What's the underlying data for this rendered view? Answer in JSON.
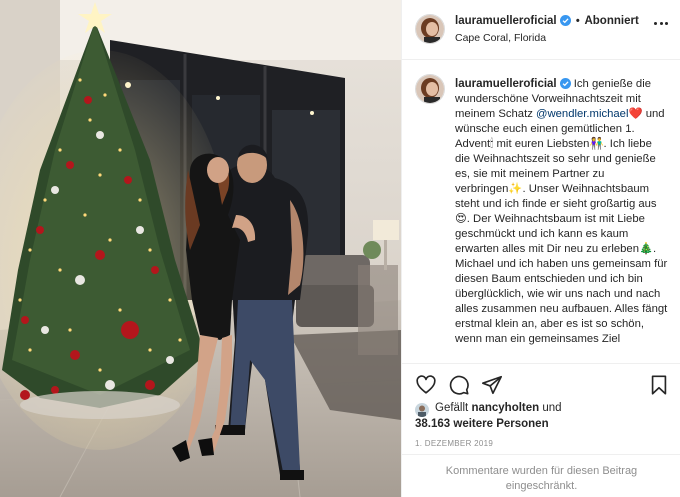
{
  "post": {
    "username": "lauramuelleroficial",
    "follow_label": "Abonniert",
    "location": "Cape Coral, Florida"
  },
  "caption": {
    "username": "lauramuelleroficial",
    "part1": " Ich genieße die wunderschöne Vorweihnachtszeit mit meinem Schatz ",
    "mention": "@wendler.michael",
    "part2": "❤️ und wünsche euch einen gemütlichen 1. Advent🕯 mit euren Liebsten👫. Ich liebe die Weihnachtszeit so sehr und genieße es, sie mit meinem Partner zu verbringen✨. Unser Weihnachtsbaum steht und ich finde er sieht großartig aus😍. Der Weihnachtsbaum ist mit Liebe geschmückt und ich kann es kaum erwarten alles mit Dir neu zu erleben🎄. Michael und ich haben uns gemeinsam für diesen Baum entschieden und ich bin überglücklich, wie wir uns nach und nach alles zusammen neu aufbauen. Alles fängt erstmal klein an, aber es ist so schön, wenn man ein gemeinsames Ziel"
  },
  "likes": {
    "prefix": "Gefällt ",
    "user": "nancyholten",
    "connector": " und",
    "count": "38.163 weitere Personen"
  },
  "date": "1. DEZEMBER 2019",
  "comments_disabled": "Kommentare wurden für diesen Beitrag eingeschränkt.",
  "icons": {
    "like": "heart-icon",
    "comment": "comment-icon",
    "share": "share-icon",
    "save": "bookmark-icon",
    "verified": "verified-badge-icon",
    "more": "more-options-icon"
  },
  "colors": {
    "verified": "#3897f0",
    "mention": "#00376b",
    "muted": "#8e8e8e",
    "text": "#262626"
  }
}
